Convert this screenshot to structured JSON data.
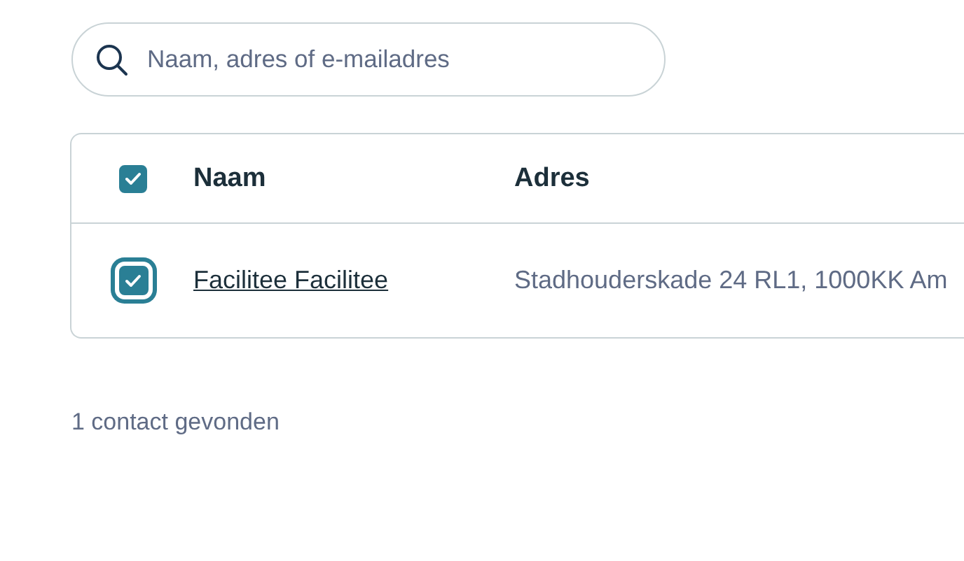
{
  "search": {
    "placeholder": "Naam, adres of e-mailadres"
  },
  "table": {
    "select_all": {
      "checked": true
    },
    "columns": [
      {
        "label": "Naam"
      },
      {
        "label": "Adres"
      }
    ],
    "rows": [
      {
        "name": "Facilitee Facilitee",
        "address": "Stadhouderskade 24 RL1, 1000KK Am",
        "checked": true,
        "focused": true
      }
    ]
  },
  "result_count": "1 contact gevonden"
}
